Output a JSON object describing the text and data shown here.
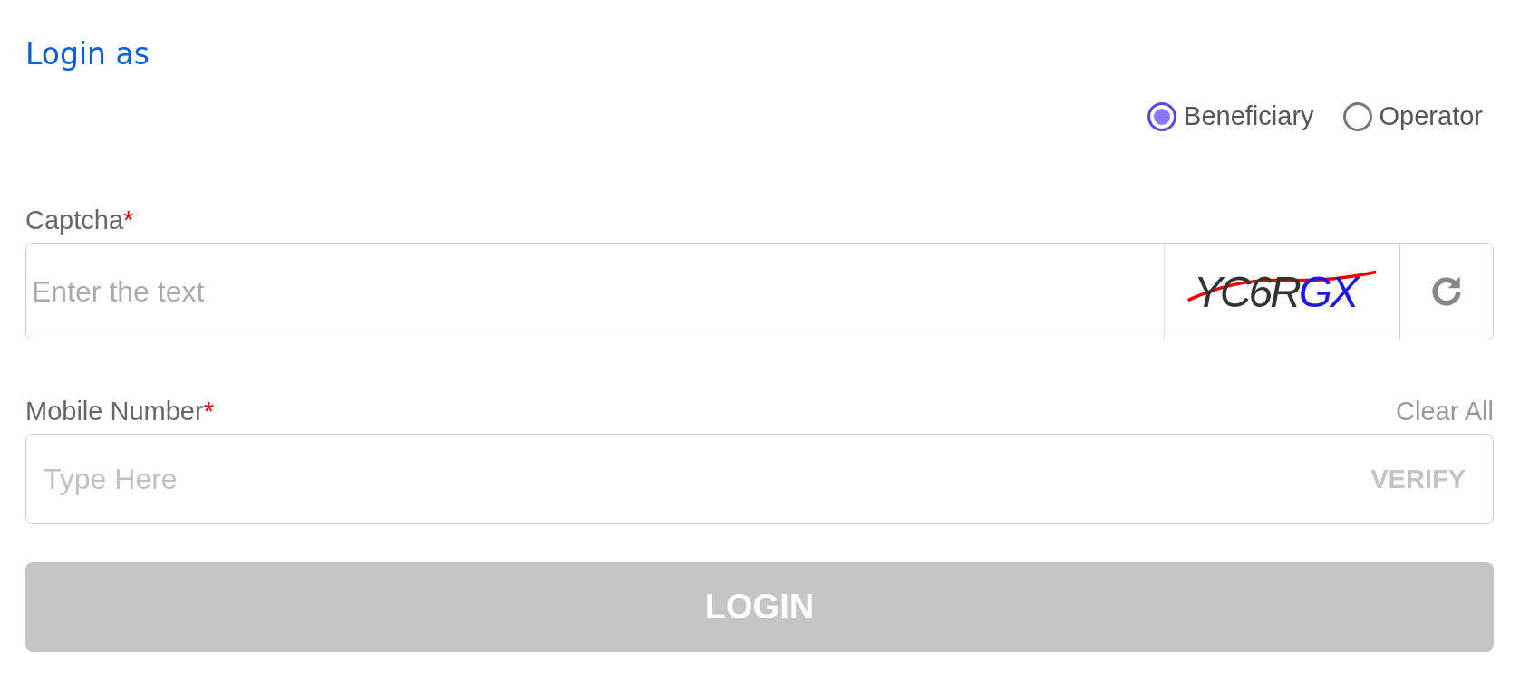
{
  "title": "Login as",
  "login_types": [
    {
      "label": "Beneficiary",
      "selected": true
    },
    {
      "label": "Operator",
      "selected": false
    }
  ],
  "captcha": {
    "label": "Captcha",
    "required_mark": "*",
    "placeholder": "Enter the text",
    "captcha_text": "YC6RGX"
  },
  "mobile": {
    "label": "Mobile Number",
    "required_mark": "*",
    "clear_label": "Clear All",
    "placeholder": "Type Here",
    "verify_label": "VERIFY",
    "verify_disabled": true
  },
  "login_button": {
    "label": "LOGIN",
    "disabled": true
  }
}
